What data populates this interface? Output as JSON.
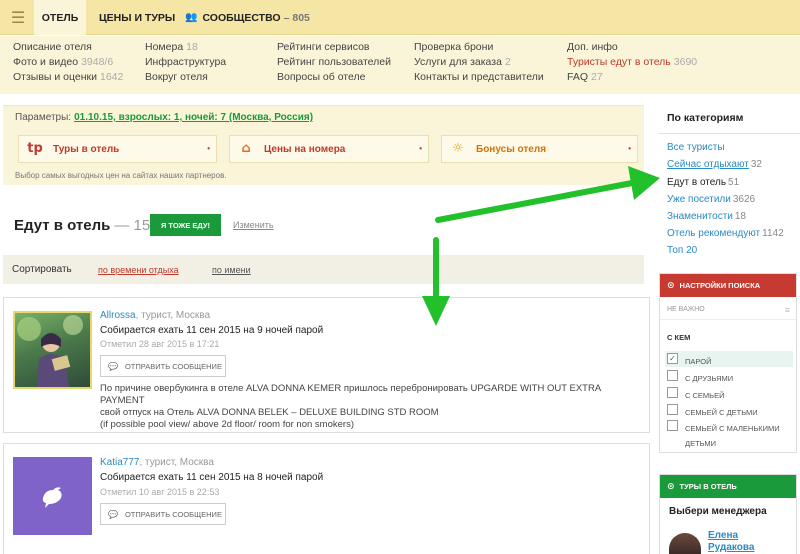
{
  "topbar": {
    "menu_icon": "hamburger-icon",
    "tabs": [
      {
        "label": "ОТЕЛЬ"
      },
      {
        "label": "ЦЕНЫ И ТУРЫ"
      },
      {
        "label": "СООБЩЕСТВО",
        "count": "– 805",
        "icon": "people-icon"
      }
    ]
  },
  "submenu": [
    {
      "label": "Описание отеля",
      "count": ""
    },
    {
      "label": "Фото и видео",
      "count": "3948/6"
    },
    {
      "label": "Отзывы и оценки",
      "count": "1642"
    },
    {
      "label": "Номера",
      "count": "18"
    },
    {
      "label": "Инфраструктура",
      "count": ""
    },
    {
      "label": "Вокруг отеля",
      "count": ""
    },
    {
      "label": "Рейтинги сервисов",
      "count": ""
    },
    {
      "label": "Рейтинг пользователей",
      "count": ""
    },
    {
      "label": "Вопросы об отеле",
      "count": ""
    },
    {
      "label": "Проверка брони",
      "count": ""
    },
    {
      "label": "Услуги для заказа",
      "count": "2"
    },
    {
      "label": "Контакты и представители",
      "count": ""
    },
    {
      "label": "Доп. инфо",
      "count": ""
    },
    {
      "label": "Туристы едут в отель",
      "count": "3690"
    },
    {
      "label": "FAQ",
      "count": "27"
    }
  ],
  "params": {
    "label": "Параметры:",
    "value": "01.10.15, взрослых: 1, ночей: 7 (Москва, Россия)",
    "buttons": [
      {
        "label": "Туры в отель",
        "icon": "tp-logo-icon"
      },
      {
        "label": "Цены на номера",
        "icon": "house-icon"
      },
      {
        "label": "Бонусы отеля",
        "icon": "sun-icon"
      }
    ],
    "note": "Выбор самых выгодных цен на сайтах наших партнеров."
  },
  "main": {
    "title": "Едут в отель",
    "count": "— 15",
    "join_button": "Я ТОЖЕ ЕДУ!",
    "change_link": "Изменить"
  },
  "sort": {
    "label": "Сортировать",
    "by_date": "по времени отдыха",
    "by_name": "по имени"
  },
  "travelers": [
    {
      "name": "Allrossa",
      "meta": ", турист, Москва",
      "trip": "Собирается ехать 11 сен 2015 на 9 ночей парой",
      "marked": "Отметил 28 авг 2015 в 17:21",
      "message_button": "ОТПРАВИТЬ СООБЩЕНИЕ",
      "description_lines": [
        "По причине овербукинга в отеле ALVA DONNA KEMER пришлось перебронировать UPGARDE WITH OUT EXTRA PAYMENT",
        "свой отпуск на Отель ALVA DONNA BELEK – DELUXE BUILDING STD ROOM",
        "(if possible pool view/ above 2d floor/ room for non smokers)"
      ]
    },
    {
      "name": "Katia777",
      "meta": ", турист, Москва",
      "trip": "Собирается ехать 11 сен 2015 на 8 ночей парой",
      "marked": "Отметил 10 авг 2015 в 22:53",
      "message_button": "ОТПРАВИТЬ СООБЩЕНИЕ"
    }
  ],
  "sidebar": {
    "title": "По категориям",
    "categories": [
      {
        "label": "Все туристы",
        "count": ""
      },
      {
        "label": "Сейчас отдыхают",
        "count": "32"
      },
      {
        "label": "Едут в отель",
        "count": "51"
      },
      {
        "label": "Уже посетили",
        "count": "3626"
      },
      {
        "label": "Знаменитости",
        "count": "18"
      },
      {
        "label": "Отель рекомендуют",
        "count": "1142"
      },
      {
        "label": "Топ 20",
        "count": ""
      }
    ]
  },
  "search_settings": {
    "title": "НАСТРОЙКИ ПОИСКА",
    "select_value": "НЕ ВАЖНО",
    "with_label": "С КЕМ",
    "options": [
      {
        "label": "ПАРОЙ",
        "checked": true
      },
      {
        "label": "С ДРУЗЬЯМИ",
        "checked": false
      },
      {
        "label": "С СЕМЬЕЙ",
        "checked": false
      },
      {
        "label": "СЕМЬЕЙ С ДЕТЬМИ",
        "checked": false
      },
      {
        "label": "СЕМЬЕЙ С МАЛЕНЬКИМИ ДЕТЬМИ",
        "checked": false
      }
    ]
  },
  "tours_widget": {
    "title": "ТУРЫ В ОТЕЛЬ",
    "subtitle": "Выбери менеджера",
    "manager_line1": "Елена",
    "manager_line2": "Рудакова"
  },
  "colors": {
    "accent_green": "#1a9a3a",
    "accent_red": "#c63a32",
    "link_blue": "#2a8ac4",
    "topbar": "#f5e6a5"
  }
}
